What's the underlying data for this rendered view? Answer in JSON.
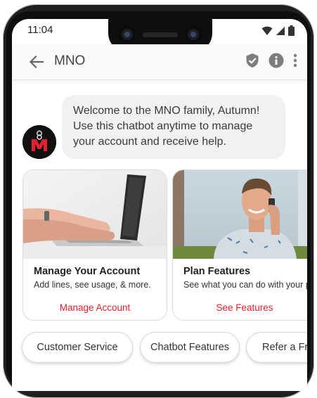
{
  "status_bar": {
    "time": "11:04",
    "icons": [
      "wifi-icon",
      "signal-icon",
      "battery-icon"
    ]
  },
  "app_bar": {
    "title": "MNO",
    "icons": [
      "back-arrow-icon",
      "verified-shield-icon",
      "info-icon",
      "more-vert-icon"
    ]
  },
  "chat": {
    "avatar_letter": "M",
    "message_lines": [
      "Welcome to the MNO family, Autumn!",
      "Use this chatbot anytime to manage",
      "your account and receive help."
    ]
  },
  "cards": [
    {
      "title": "Manage Your Account",
      "description": "Add lines, see usage, & more.",
      "action": "Manage Account"
    },
    {
      "title": "Plan Features",
      "description": "See what you can do with your p",
      "action": "See Features"
    }
  ],
  "suggestions": [
    "Customer Service",
    "Chatbot Features",
    "Refer a Fr"
  ],
  "colors": {
    "accent_red": "#e3202c",
    "bubble_bg": "#f1f1f1",
    "avatar_bg": "#111111"
  }
}
